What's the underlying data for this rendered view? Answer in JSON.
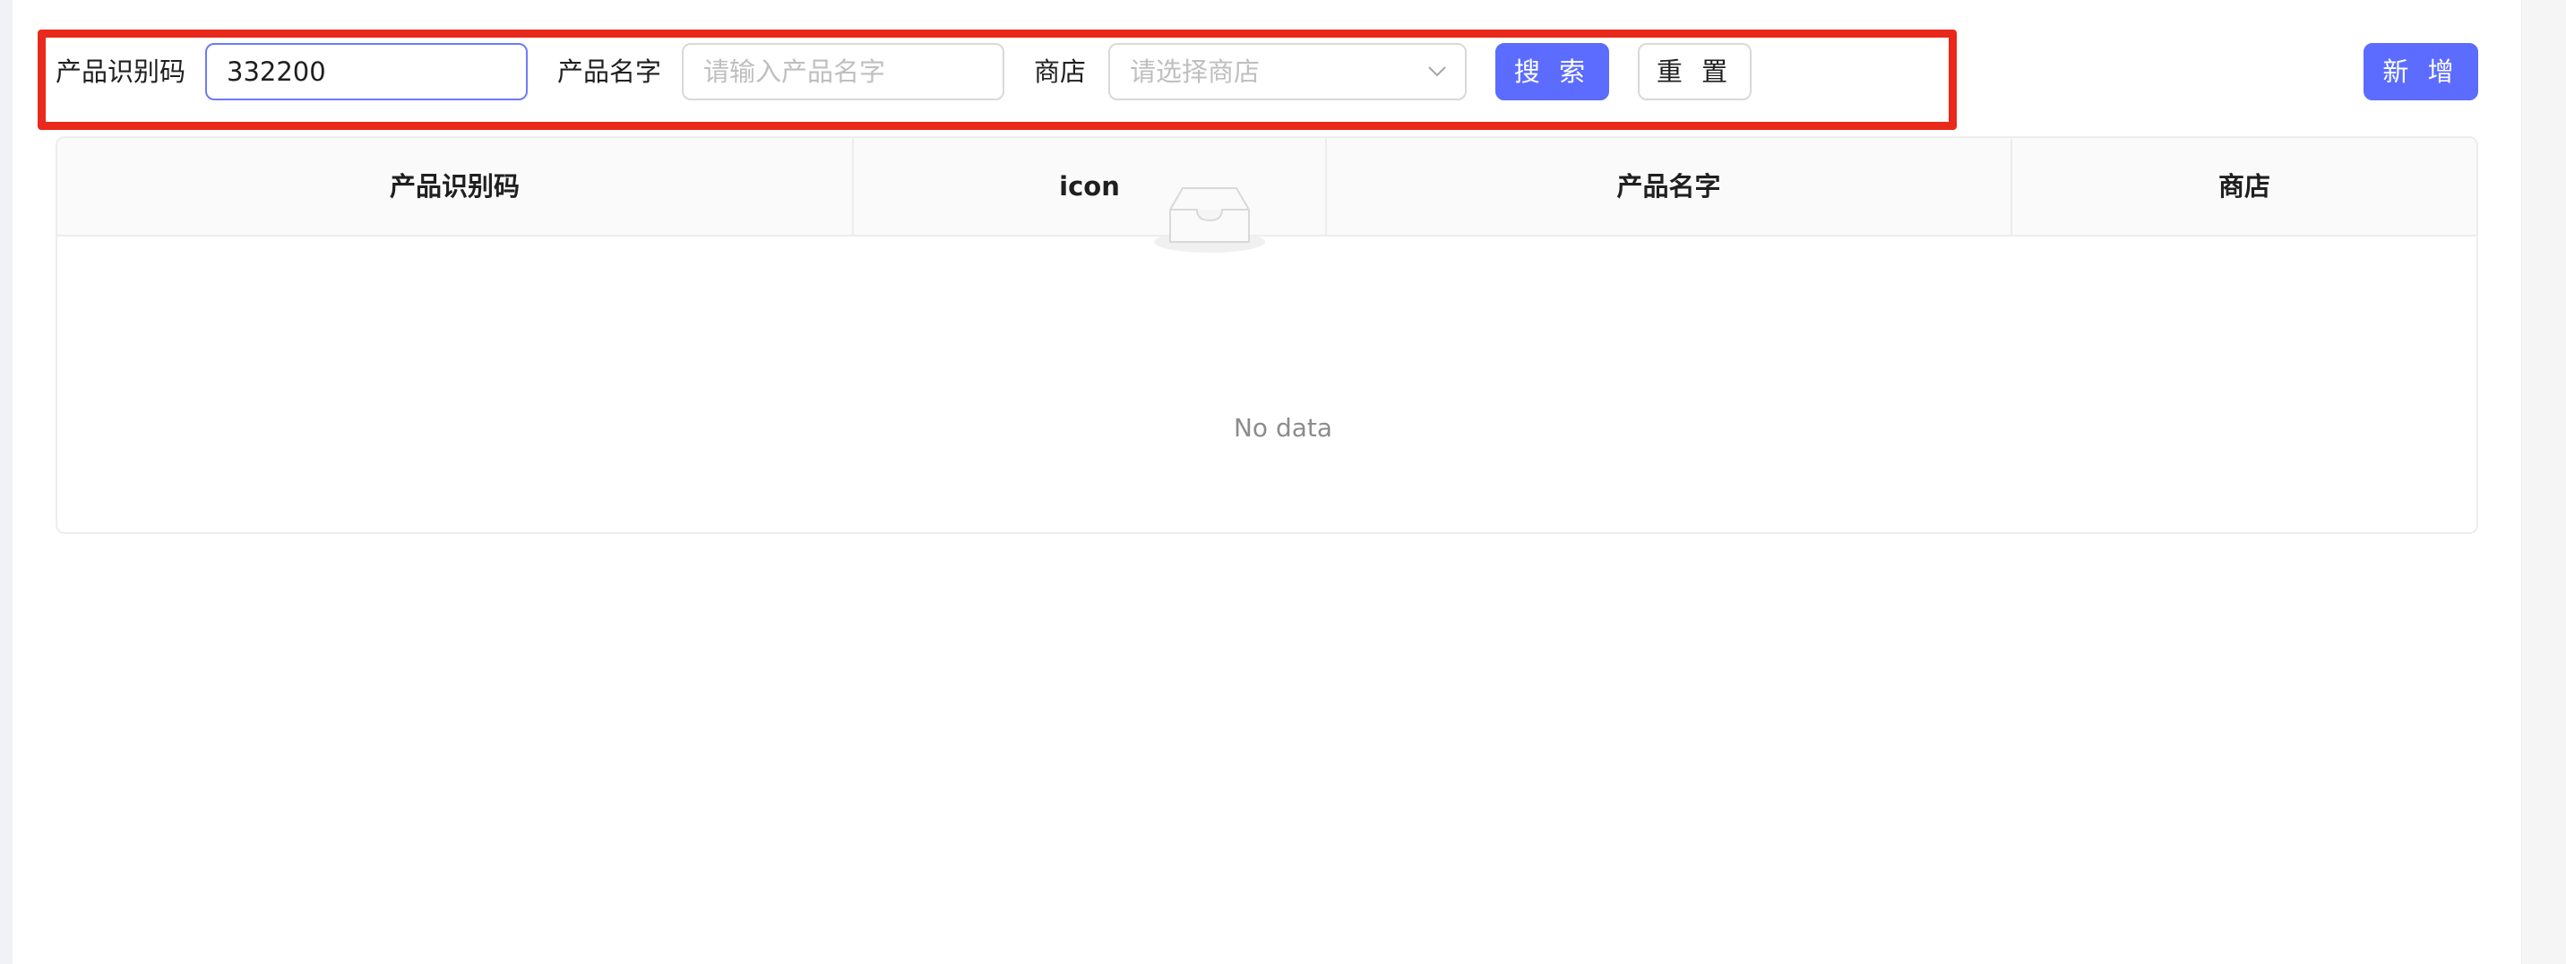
{
  "filters": {
    "code_label": "产品识别码",
    "code_value": "332200",
    "name_label": "产品名字",
    "name_placeholder": "请输入产品名字",
    "shop_label": "商店",
    "shop_placeholder": "请选择商店"
  },
  "actions": {
    "search_label": "搜 索",
    "reset_label": "重 置",
    "add_label": "新 增"
  },
  "table": {
    "columns": [
      "产品识别码",
      "icon",
      "产品名字",
      "商店"
    ],
    "rows": [],
    "empty_text": "No data"
  },
  "colors": {
    "primary": "#5b6cff",
    "highlight_border": "#e8291b"
  }
}
